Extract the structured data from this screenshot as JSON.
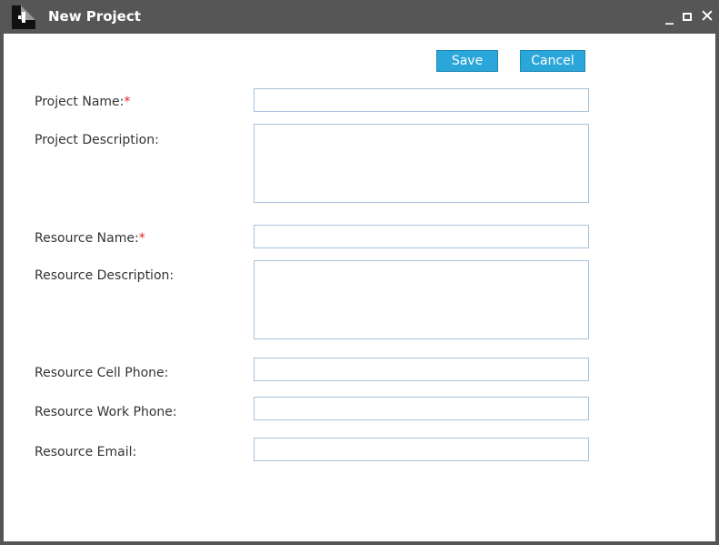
{
  "window": {
    "title": "New Project",
    "minimize_label": "_",
    "close_label": "✕"
  },
  "toolbar": {
    "save_label": "Save",
    "cancel_label": "Cancel"
  },
  "form": {
    "project_name": {
      "label": "Project Name:",
      "required_mark": "*",
      "value": ""
    },
    "project_description": {
      "label": "Project Description:",
      "value": ""
    },
    "resource_name": {
      "label": "Resource Name:",
      "required_mark": "*",
      "value": ""
    },
    "resource_description": {
      "label": "Resource Description:",
      "value": ""
    },
    "resource_cell_phone": {
      "label": "Resource Cell Phone:",
      "value": ""
    },
    "resource_work_phone": {
      "label": "Resource Work Phone:",
      "value": ""
    },
    "resource_email": {
      "label": "Resource Email:",
      "value": ""
    }
  },
  "colors": {
    "titlebar": "#565656",
    "button": "#2aa6da",
    "required": "#e02020",
    "field_border": "#a9c1dc"
  }
}
